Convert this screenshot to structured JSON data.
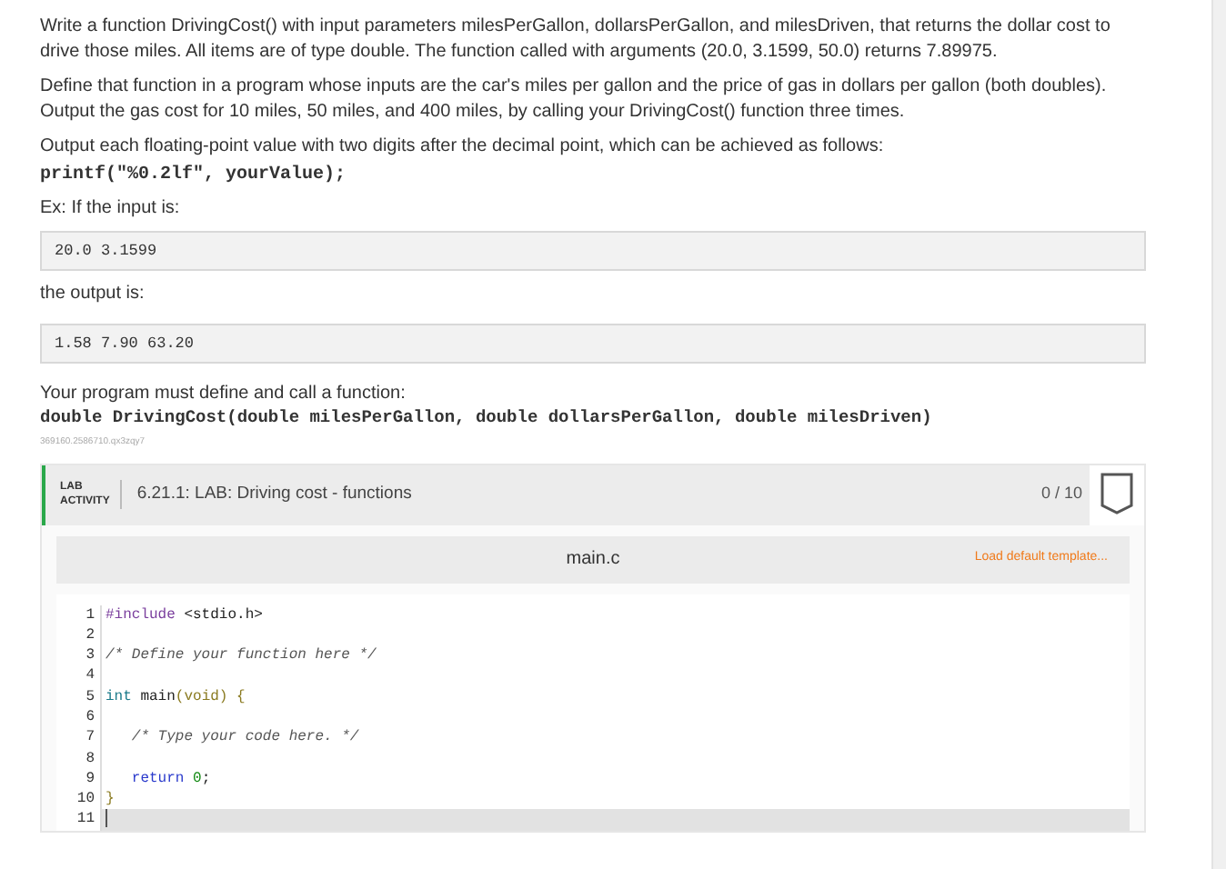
{
  "intro": [
    "Write a function DrivingCost() with input parameters milesPerGallon, dollarsPerGallon, and milesDriven, that returns the dollar cost to drive those miles. All items are of type double. The function called with arguments (20.0, 3.1599, 50.0) returns 7.89975.",
    "Define that function in a program whose inputs are the car's miles per gallon and the price of gas in dollars per gallon (both doubles). Output the gas cost for 10 miles, 50 miles, and 400 miles, by calling your DrivingCost() function three times.",
    "Output each floating-point value with two digits after the decimal point, which can be achieved as follows:"
  ],
  "printf_code": "printf(\"%0.2lf\", yourValue);",
  "example_label": "Ex: If the input is:",
  "example_input": "20.0 3.1599",
  "output_label": "the output is:",
  "example_output": "1.58 7.90 63.20",
  "requirement": "Your program must define and call a function:",
  "signature": "double DrivingCost(double milesPerGallon, double dollarsPerGallon, double milesDriven)",
  "id_code": "369160.2586710.qx3zqy7",
  "lab": {
    "tag_line1": "LAB",
    "tag_line2": "ACTIVITY",
    "title": "6.21.1: LAB: Driving cost - functions",
    "score": "0 / 10"
  },
  "editor": {
    "filename": "main.c",
    "load_template": "Load default template...",
    "lines": [
      {
        "number": "1",
        "current": false,
        "tokens": [
          {
            "text": "#include",
            "kind": "directive"
          },
          {
            "text": " <stdio.h>",
            "kind": "plain"
          }
        ]
      },
      {
        "number": "2",
        "current": false
      },
      {
        "number": "3",
        "current": false,
        "tokens": [
          {
            "text": "/* Define your function here */",
            "kind": "comment"
          }
        ]
      },
      {
        "number": "4",
        "current": false
      },
      {
        "number": "5",
        "current": false,
        "tokens": [
          {
            "text": "int",
            "kind": "type"
          },
          {
            "text": " main",
            "kind": "plain"
          },
          {
            "text": "(void) {",
            "kind": "bracket"
          }
        ]
      },
      {
        "number": "6",
        "current": false
      },
      {
        "number": "7",
        "current": false,
        "tokens": [
          {
            "text": "   /* Type your code here. */",
            "kind": "comment"
          }
        ]
      },
      {
        "number": "8",
        "current": false
      },
      {
        "number": "9",
        "current": false,
        "tokens": [
          {
            "text": "   return",
            "kind": "keyword"
          },
          {
            "text": " 0",
            "kind": "number"
          },
          {
            "text": ";",
            "kind": "plain"
          }
        ]
      },
      {
        "number": "10",
        "current": false,
        "tokens": [
          {
            "text": "}",
            "kind": "bracket"
          }
        ]
      },
      {
        "number": "11",
        "current": true
      }
    ]
  }
}
